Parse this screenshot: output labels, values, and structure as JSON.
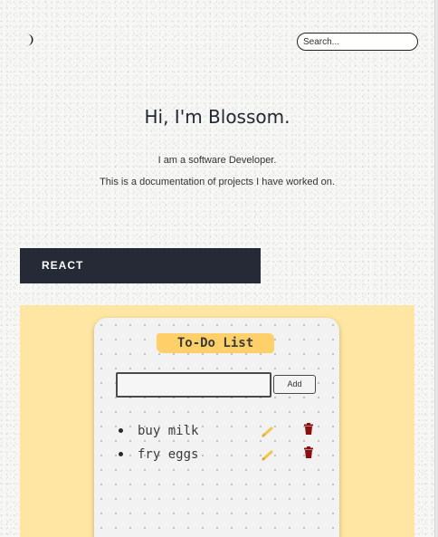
{
  "header": {
    "theme_icon": "moon-icon",
    "search": {
      "placeholder": "Search...",
      "value": ""
    }
  },
  "hero": {
    "title": "Hi, I'm Blossom.",
    "line1": "I am a software Developer.",
    "line2": "This is a documentation of projects I have worked on."
  },
  "section": {
    "label": "REACT"
  },
  "project_preview": {
    "background": "#ffe7a3",
    "title": "To-Do List",
    "input_value": "",
    "add_label": "Add",
    "items": [
      {
        "text": "buy milk",
        "edit_icon": "pencil-icon",
        "delete_icon": "trash-icon"
      },
      {
        "text": "fry eggs",
        "edit_icon": "pencil-icon",
        "delete_icon": "trash-icon"
      }
    ]
  },
  "colors": {
    "section_bar": "#262a36",
    "title_tag": "#ffd06a",
    "delete_icon": "#8a1010",
    "edit_icon": "#f2c64a"
  }
}
